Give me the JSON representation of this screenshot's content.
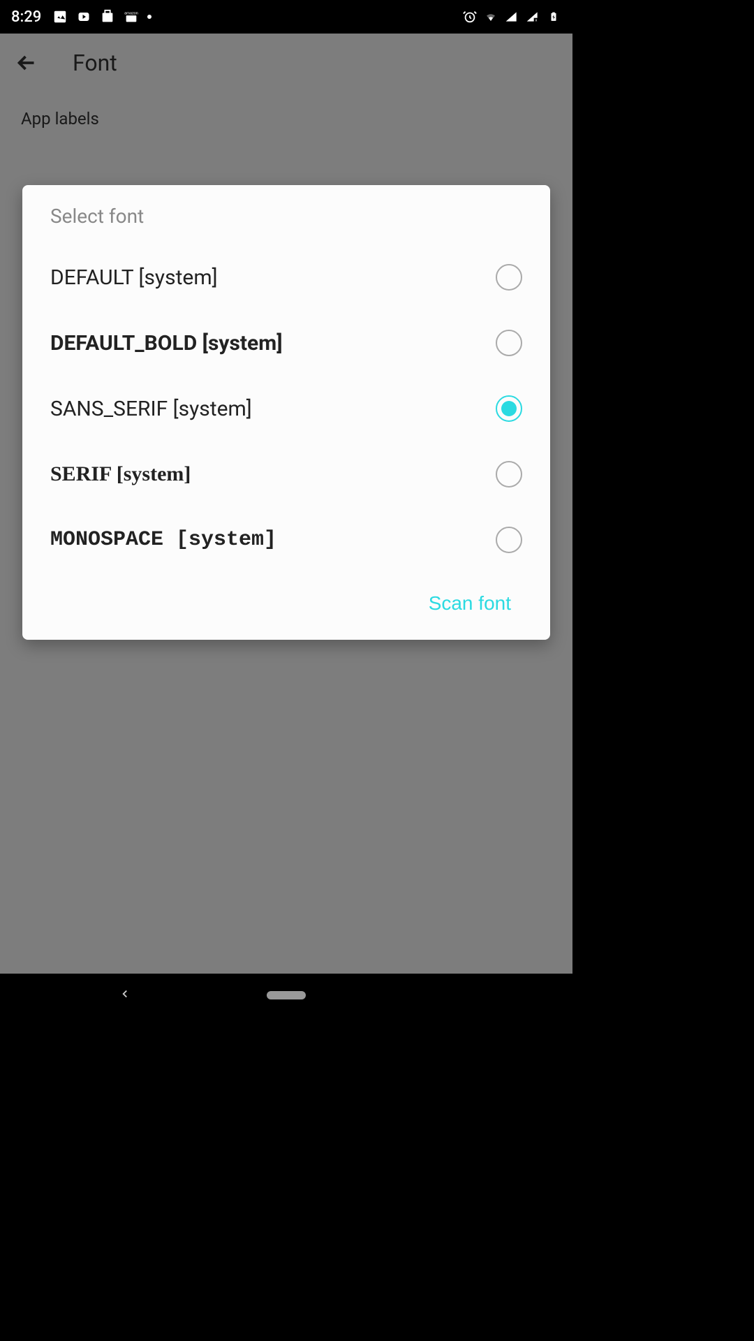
{
  "status": {
    "time": "8:29"
  },
  "header": {
    "title": "Font"
  },
  "section": {
    "label": "App labels"
  },
  "dialog": {
    "title": "Select font",
    "options": [
      {
        "label": "DEFAULT [system]",
        "selected": false,
        "style": "normal"
      },
      {
        "label": "DEFAULT_BOLD [system]",
        "selected": false,
        "style": "bold"
      },
      {
        "label": "SANS_SERIF [system]",
        "selected": true,
        "style": "normal"
      },
      {
        "label": "SERIF [system]",
        "selected": false,
        "style": "serif"
      },
      {
        "label": "MONOSPACE [system]",
        "selected": false,
        "style": "mono"
      }
    ],
    "action": "Scan font"
  },
  "colors": {
    "accent": "#2BDAE1"
  }
}
